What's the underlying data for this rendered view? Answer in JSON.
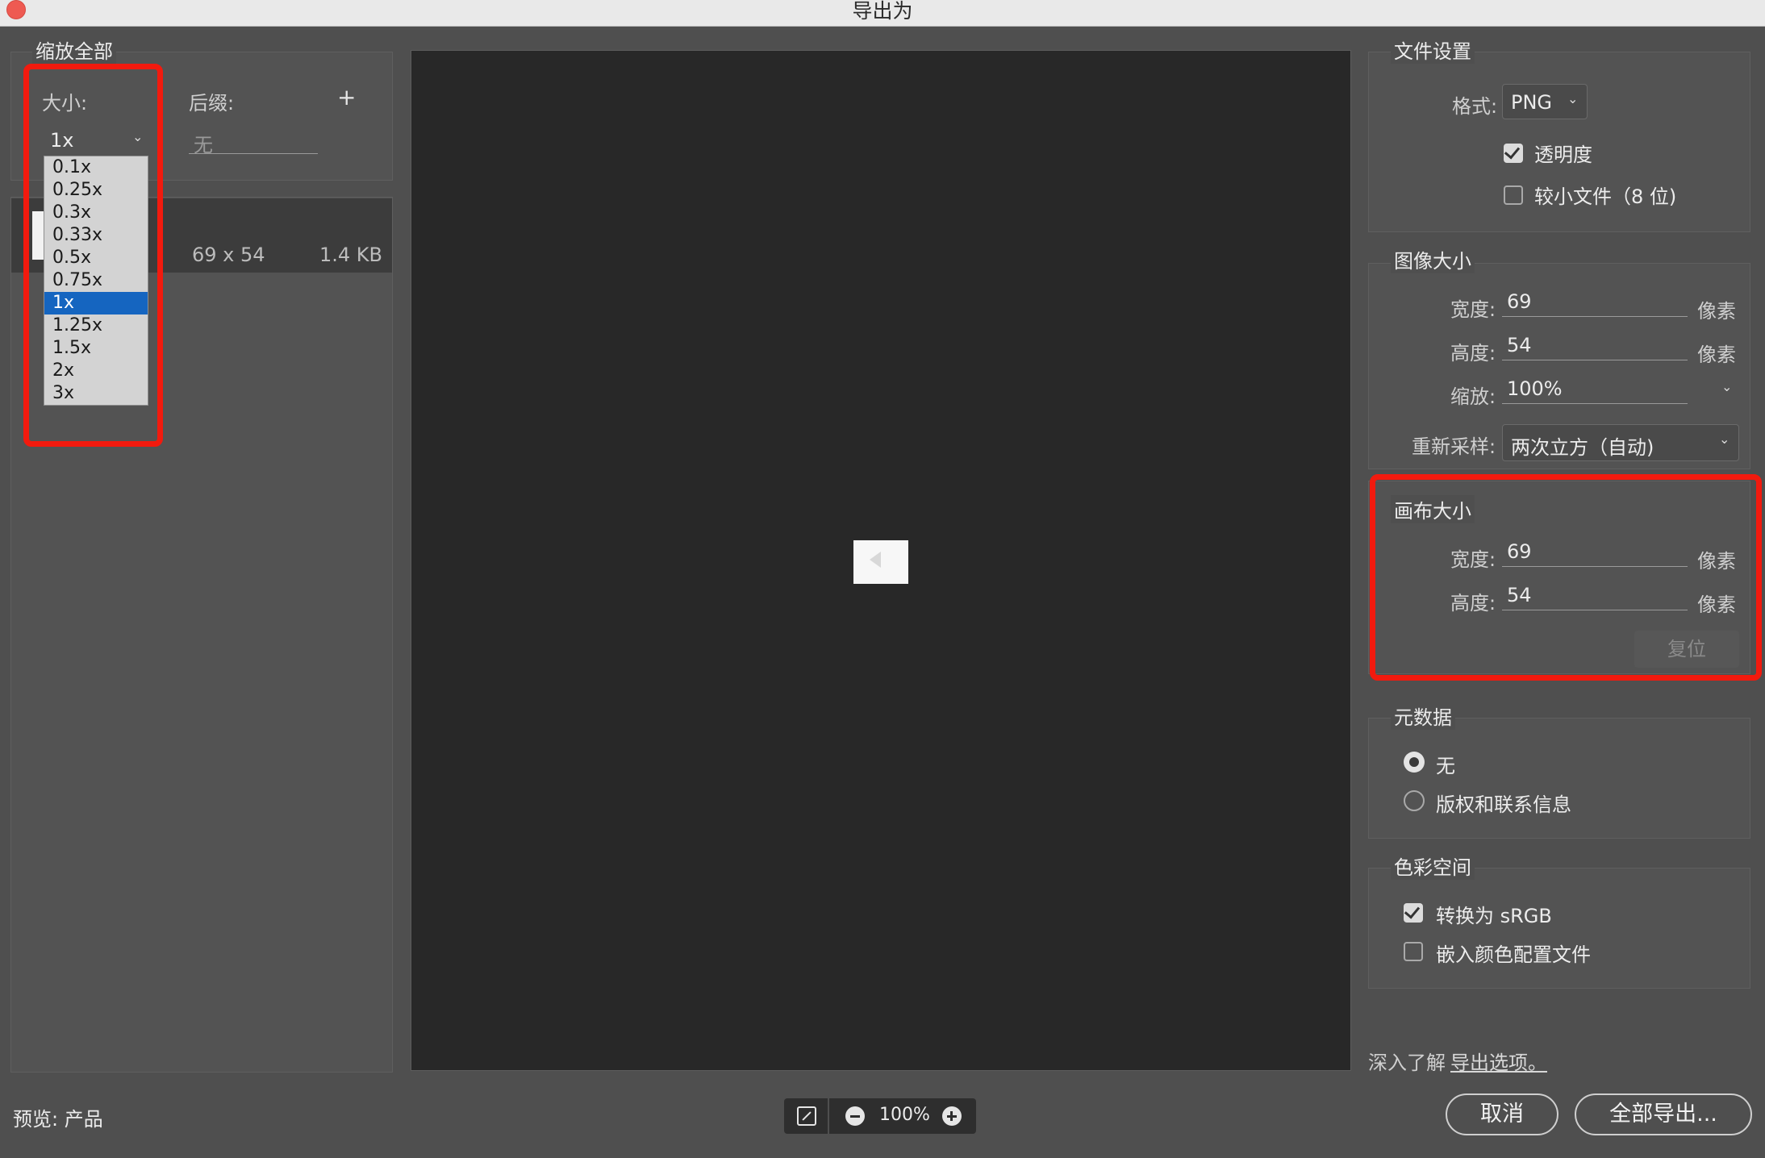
{
  "window": {
    "title": "导出为"
  },
  "left": {
    "section_title": "缩放全部",
    "size_label": "大小:",
    "suffix_label": "后缀:",
    "add_icon": "plus-icon",
    "size_value": "1x",
    "suffix_placeholder": "无",
    "size_options": [
      "0.1x",
      "0.25x",
      "0.3x",
      "0.33x",
      "0.5x",
      "0.75x",
      "1x",
      "1.25x",
      "1.5x",
      "2x",
      "3x"
    ],
    "selected_option": "1x",
    "asset": {
      "dimensions": "69 x 54",
      "filesize": "1.4 KB"
    }
  },
  "preview": {
    "zoom": "100%",
    "label": "预览: 产品"
  },
  "file_settings": {
    "title": "文件设置",
    "format_label": "格式:",
    "format_value": "PNG",
    "transparency_label": "透明度",
    "transparency_checked": true,
    "smaller_file_label": "较小文件（8 位)",
    "smaller_file_checked": false
  },
  "image_size": {
    "title": "图像大小",
    "width_label": "宽度:",
    "width_value": "69",
    "height_label": "高度:",
    "height_value": "54",
    "unit": "像素",
    "scale_label": "缩放:",
    "scale_value": "100%",
    "resample_label": "重新采样:",
    "resample_value": "两次立方（自动)"
  },
  "canvas_size": {
    "title": "画布大小",
    "width_label": "宽度:",
    "width_value": "69",
    "height_label": "高度:",
    "height_value": "54",
    "unit": "像素",
    "reset_label": "复位"
  },
  "metadata": {
    "title": "元数据",
    "option_none": "无",
    "option_copyright": "版权和联系信息",
    "selected": "无"
  },
  "color_space": {
    "title": "色彩空间",
    "convert_label": "转换为 sRGB",
    "convert_checked": true,
    "embed_label": "嵌入颜色配置文件",
    "embed_checked": false
  },
  "footer": {
    "learn_more_prefix": "深入了解",
    "learn_more_link": "导出选项。",
    "cancel_label": "取消",
    "export_all_label": "全部导出..."
  },
  "colors": {
    "highlight_red": "#f21a0e",
    "selection_blue": "#1565c0"
  }
}
